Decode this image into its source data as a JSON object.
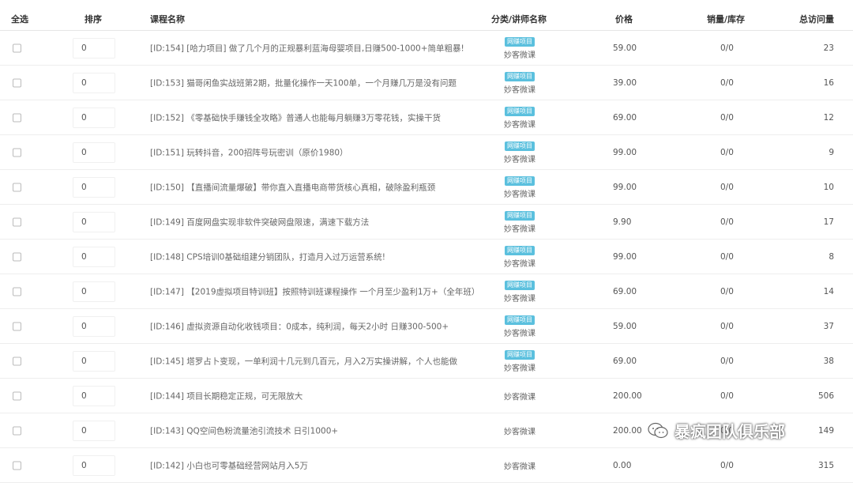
{
  "header": {
    "select_all": "全选",
    "sort": "排序",
    "course_name": "课程名称",
    "category": "分类/讲师名称",
    "price": "价格",
    "sales_stock": "销量/库存",
    "total_visits": "总访问量"
  },
  "rows": [
    {
      "sort": "0",
      "name": "[ID:154] [哈力项目] 做了几个月的正规暴利蓝海母婴项目,日赚500-1000+简单粗暴!",
      "tag": "网赚项目",
      "teacher": "妙客微课",
      "price": "59.00",
      "stock": "0/0",
      "visits": "23"
    },
    {
      "sort": "0",
      "name": "[ID:153] 猫哥闲鱼实战班第2期，批量化操作一天100单，一个月赚几万是没有问题",
      "tag": "网赚项目",
      "teacher": "妙客微课",
      "price": "39.00",
      "stock": "0/0",
      "visits": "16"
    },
    {
      "sort": "0",
      "name": "[ID:152] 《零基础快手赚钱全攻略》普通人也能每月躺赚3万零花钱，实操干货",
      "tag": "网赚项目",
      "teacher": "妙客微课",
      "price": "69.00",
      "stock": "0/0",
      "visits": "12"
    },
    {
      "sort": "0",
      "name": "[ID:151] 玩转抖音，200招阵号玩密训（原价1980）",
      "tag": "网赚项目",
      "teacher": "妙客微课",
      "price": "99.00",
      "stock": "0/0",
      "visits": "9"
    },
    {
      "sort": "0",
      "name": "[ID:150] 【直播间流量爆破】带你直入直播电商带货核心真相，破除盈利瓶颈",
      "tag": "网赚项目",
      "teacher": "妙客微课",
      "price": "99.00",
      "stock": "0/0",
      "visits": "10"
    },
    {
      "sort": "0",
      "name": "[ID:149] 百度网盘实现非软件突破网盘限速，满速下载方法",
      "tag": "网赚项目",
      "teacher": "妙客微课",
      "price": "9.90",
      "stock": "0/0",
      "visits": "17"
    },
    {
      "sort": "0",
      "name": "[ID:148] CPS培训0基础组建分销团队，打造月入过万运营系统!",
      "tag": "网赚项目",
      "teacher": "妙客微课",
      "price": "99.00",
      "stock": "0/0",
      "visits": "8"
    },
    {
      "sort": "0",
      "name": "[ID:147] 【2019虚拟项目特训班】按照特训班课程操作 一个月至少盈利1万+（全年班）",
      "tag": "网赚项目",
      "teacher": "妙客微课",
      "price": "69.00",
      "stock": "0/0",
      "visits": "14"
    },
    {
      "sort": "0",
      "name": "[ID:146] 虚拟资源自动化收钱项目：0成本，纯利润，每天2小时 日赚300-500+",
      "tag": "网赚项目",
      "teacher": "妙客微课",
      "price": "59.00",
      "stock": "0/0",
      "visits": "37"
    },
    {
      "sort": "0",
      "name": "[ID:145] 塔罗占卜变现，一单利润十几元到几百元，月入2万实操讲解，个人也能做",
      "tag": "网赚项目",
      "teacher": "妙客微课",
      "price": "69.00",
      "stock": "0/0",
      "visits": "38"
    },
    {
      "sort": "0",
      "name": "[ID:144] 项目长期稳定正规，可无限放大",
      "tag": "",
      "teacher": "妙客微课",
      "price": "200.00",
      "stock": "0/0",
      "visits": "506"
    },
    {
      "sort": "0",
      "name": "[ID:143] QQ空间色粉流量池引流技术 日引1000+",
      "tag": "",
      "teacher": "妙客微课",
      "price": "200.00",
      "stock": "0/0",
      "visits": "149"
    },
    {
      "sort": "0",
      "name": "[ID:142] 小白也可零基础经营网站月入5万",
      "tag": "",
      "teacher": "妙客微课",
      "price": "0.00",
      "stock": "0/0",
      "visits": "315"
    }
  ],
  "watermark": "暴疯团队俱乐部",
  "colors": {
    "tag_bg": "#5bc0de"
  }
}
